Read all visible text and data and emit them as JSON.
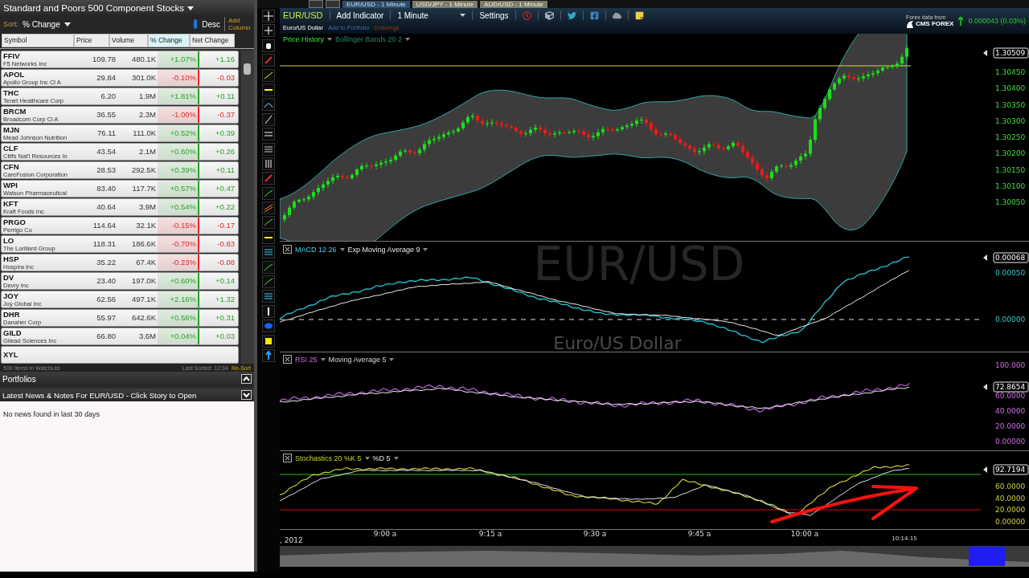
{
  "watchlist": {
    "title": "Standard and Poors 500 Component Stocks",
    "sort_label": "Sort:",
    "sort_value": "% Change",
    "order": "Desc",
    "add_column": "Add Column",
    "columns": [
      {
        "label": "Symbol",
        "selected": false
      },
      {
        "label": "Price",
        "selected": false
      },
      {
        "label": "Volume",
        "selected": false
      },
      {
        "label": "% Change",
        "selected": true
      },
      {
        "label": "Net Change",
        "selected": false
      }
    ],
    "rows": [
      {
        "symbol": "FFIV",
        "name": "F5 Networks Inc",
        "price": "109.78",
        "volume": "480.1K",
        "change_pct": "+1.07%",
        "net_change": "+1.16",
        "color": "#2aa42a"
      },
      {
        "symbol": "APOL",
        "name": "Apollo Group Inc Cl A",
        "price": "29.84",
        "volume": "301.0K",
        "change_pct": "-0.10%",
        "net_change": "-0.03",
        "color": "#e82828"
      },
      {
        "symbol": "THC",
        "name": "Tenet Healthcare Corp",
        "price": "6.20",
        "volume": "1.9M",
        "change_pct": "+1.81%",
        "net_change": "+0.11",
        "color": "#2aa42a"
      },
      {
        "symbol": "BRCM",
        "name": "Broadcom Corp Cl A",
        "price": "36.55",
        "volume": "2.3M",
        "change_pct": "-1.00%",
        "net_change": "-0.37",
        "color": "#e82828"
      },
      {
        "symbol": "MJN",
        "name": "Mead Johnson Nutrition",
        "price": "76.11",
        "volume": "111.0K",
        "change_pct": "+0.52%",
        "net_change": "+0.39",
        "color": "#2aa42a"
      },
      {
        "symbol": "CLF",
        "name": "Cliffs Nat'l Resources In",
        "price": "43.54",
        "volume": "2.1M",
        "change_pct": "+0.60%",
        "net_change": "+0.26",
        "color": "#2aa42a"
      },
      {
        "symbol": "CFN",
        "name": "CareFusion Corporation",
        "price": "28.53",
        "volume": "292.5K",
        "change_pct": "+0.39%",
        "net_change": "+0.11",
        "color": "#2aa42a"
      },
      {
        "symbol": "WPI",
        "name": "Watson Pharmaceutical",
        "price": "83.40",
        "volume": "117.7K",
        "change_pct": "+0.57%",
        "net_change": "+0.47",
        "color": "#2aa42a"
      },
      {
        "symbol": "KFT",
        "name": "Kraft Foods Inc",
        "price": "40.64",
        "volume": "3.9M",
        "change_pct": "+0.54%",
        "net_change": "+0.22",
        "color": "#2aa42a"
      },
      {
        "symbol": "PRGO",
        "name": "Perrigo Co",
        "price": "114.64",
        "volume": "32.1K",
        "change_pct": "-0.15%",
        "net_change": "-0.17",
        "color": "#e82828"
      },
      {
        "symbol": "LO",
        "name": "The Lorillard Group",
        "price": "118.31",
        "volume": "186.6K",
        "change_pct": "-0.70%",
        "net_change": "-0.83",
        "color": "#e82828"
      },
      {
        "symbol": "HSP",
        "name": "Hospira Inc",
        "price": "35.22",
        "volume": "67.4K",
        "change_pct": "-0.23%",
        "net_change": "-0.08",
        "color": "#e82828"
      },
      {
        "symbol": "DV",
        "name": "Devry Inc",
        "price": "23.40",
        "volume": "197.0K",
        "change_pct": "+0.60%",
        "net_change": "+0.14",
        "color": "#2aa42a"
      },
      {
        "symbol": "JOY",
        "name": "Joy Global Inc",
        "price": "62.56",
        "volume": "497.1K",
        "change_pct": "+2.16%",
        "net_change": "+1.32",
        "color": "#2aa42a"
      },
      {
        "symbol": "DHR",
        "name": "Danaher Corp",
        "price": "55.97",
        "volume": "642.6K",
        "change_pct": "+0.56%",
        "net_change": "+0.31",
        "color": "#2aa42a"
      },
      {
        "symbol": "GILD",
        "name": "Gilead Sciences Inc",
        "price": "66.80",
        "volume": "3.6M",
        "change_pct": "+0.04%",
        "net_change": "+0.03",
        "color": "#2aa42a"
      }
    ],
    "partial_row": {
      "symbol": "XYL"
    },
    "footer": {
      "count": "500 Items in WatchList",
      "last_sorted": "Last Sorted: 12:34",
      "resort": "Re-Sort"
    }
  },
  "portfolios": {
    "title": "Portfolios"
  },
  "news": {
    "title": "Latest News & Notes For EUR/USD - Click Story to Open",
    "message": "No news found in last 30 days"
  },
  "chart_tabs": [
    {
      "label": "EUR/USD - 1 Minute",
      "selected": true
    },
    {
      "label": "USD/JPY - 1 Minute",
      "selected": false
    },
    {
      "label": "AUD/USD - 1 Minute",
      "selected": false
    }
  ],
  "toolbar": {
    "symbol": "EUR/USD",
    "add_indicator": "Add Indicator",
    "interval": "1 Minute",
    "settings": "Settings"
  },
  "subtitle": {
    "name": "Euro/US Dollar",
    "add_to_portfolio": "Add to Portfolio",
    "drawings": "Drawings"
  },
  "data_source": {
    "label": "Forex data from",
    "provider": "CMS FOREX",
    "change": "0.000043 (0.03%)"
  },
  "panels": [
    {
      "kind": "price",
      "labels": [
        "Price History",
        "Bollinger Bands 20 2"
      ],
      "axis": [
        "1.30450",
        "1.30400",
        "1.30350",
        "1.30300",
        "1.30250",
        "1.30200",
        "1.30150",
        "1.30100",
        "1.30050"
      ],
      "current": "1.30509"
    },
    {
      "kind": "macd",
      "labels": [
        "MACD 12 26",
        "Exp Moving Average 9"
      ],
      "axis": [
        "0.00050",
        "0.00000"
      ],
      "current": "0.00068",
      "watermark": [
        "EUR/USD",
        "Euro/US Dollar"
      ]
    },
    {
      "kind": "rsi",
      "labels": [
        "RSI 25",
        "Moving Average 5"
      ],
      "axis": [
        "100.000",
        "60.0000",
        "40.0000",
        "20.0000",
        "0.00000"
      ],
      "current": "72.8654"
    },
    {
      "kind": "stochastics",
      "labels": [
        "Stochastics 20 %K 5",
        "%D 5"
      ],
      "axis": [
        "60.0000",
        "40.0000",
        "20.0000",
        "0.00000"
      ],
      "current": "92.7194"
    }
  ],
  "time_axis": {
    "date": ", 2012",
    "ticks": [
      "9:00 a",
      "9:15 a",
      "9:30 a",
      "9:45 a",
      "10:00 a"
    ],
    "last": "10:14:15"
  }
}
